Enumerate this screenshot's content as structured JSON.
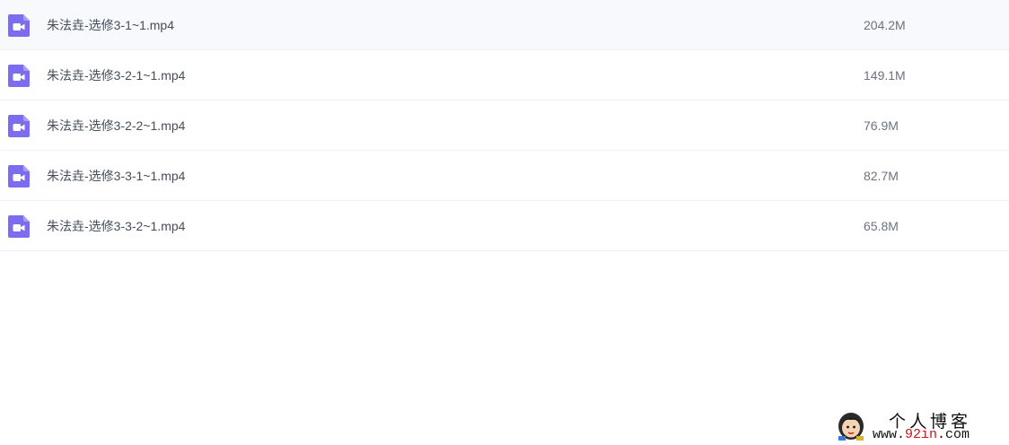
{
  "colors": {
    "icon_accent": "#7b6cf0",
    "divider": "#eef0f4",
    "name_text": "#454d5a",
    "size_text": "#6b7280"
  },
  "files": [
    {
      "name": "朱法垚-选修3-1~1.mp4",
      "size": "204.2M",
      "icon": "video-file-icon"
    },
    {
      "name": "朱法垚-选修3-2-1~1.mp4",
      "size": "149.1M",
      "icon": "video-file-icon"
    },
    {
      "name": "朱法垚-选修3-2-2~1.mp4",
      "size": "76.9M",
      "icon": "video-file-icon"
    },
    {
      "name": "朱法垚-选修3-3-1~1.mp4",
      "size": "82.7M",
      "icon": "video-file-icon"
    },
    {
      "name": "朱法垚-选修3-3-2~1.mp4",
      "size": "65.8M",
      "icon": "video-file-icon"
    }
  ],
  "watermark": {
    "title": "个人博客",
    "url_prefix": "www.",
    "url_accent": "92in",
    "url_suffix": ".com"
  }
}
